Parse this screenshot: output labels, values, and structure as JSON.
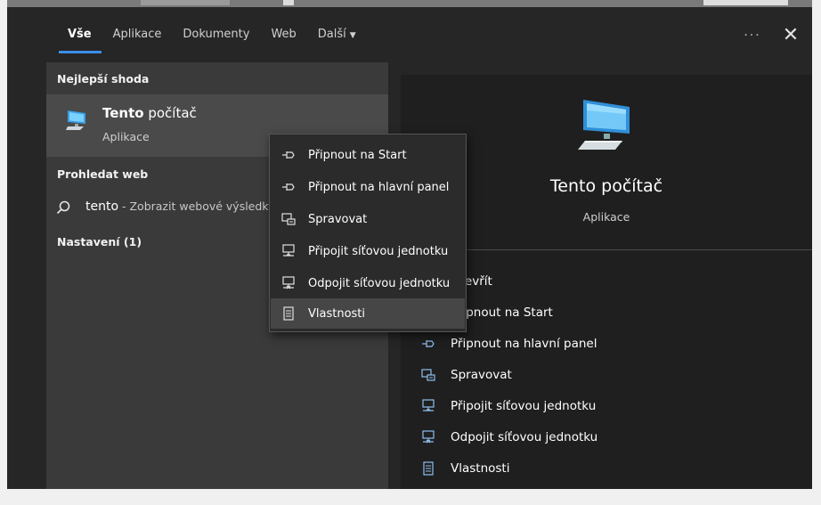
{
  "tabs": [
    {
      "label": "Vše",
      "active": true
    },
    {
      "label": "Aplikace",
      "active": false
    },
    {
      "label": "Dokumenty",
      "active": false
    },
    {
      "label": "Web",
      "active": false
    },
    {
      "label": "Další",
      "active": false,
      "dropdown": true
    }
  ],
  "header": {
    "more_icon": "ellipsis-icon",
    "more_label": "···",
    "close_icon": "close-icon",
    "close_label": "✕"
  },
  "best_match": {
    "section_title": "Nejlepší shoda",
    "title_bold": "Tento",
    "title_rest": " počítač",
    "subtitle": "Aplikace",
    "icon": "computer-icon"
  },
  "web_search": {
    "section_title": "Prohledat web",
    "query": "tento",
    "suffix": " - Zobrazit webové výsledky",
    "icon": "search-icon"
  },
  "settings": {
    "section_title": "Nastavení (1)"
  },
  "preview": {
    "title": "Tento počítač",
    "subtitle": "Aplikace",
    "icon": "computer-icon",
    "actions": [
      {
        "label": "Otevřít",
        "icon": "open-icon"
      },
      {
        "label": "Připnout na Start",
        "icon": "pin-icon"
      },
      {
        "label": "Připnout na hlavní panel",
        "icon": "pin-icon"
      },
      {
        "label": "Spravovat",
        "icon": "manage-icon"
      },
      {
        "label": "Připojit síťovou jednotku",
        "icon": "map-drive-icon"
      },
      {
        "label": "Odpojit síťovou jednotku",
        "icon": "disconnect-drive-icon"
      },
      {
        "label": "Vlastnosti",
        "icon": "properties-icon"
      }
    ]
  },
  "context_menu": {
    "items": [
      {
        "label": "Připnout na Start",
        "icon": "pin-icon"
      },
      {
        "label": "Připnout na hlavní panel",
        "icon": "pin-icon"
      },
      {
        "label": "Spravovat",
        "icon": "manage-icon"
      },
      {
        "label": "Připojit síťovou jednotku",
        "icon": "map-drive-icon"
      },
      {
        "label": "Odpojit síťovou jednotku",
        "icon": "disconnect-drive-icon"
      },
      {
        "label": "Vlastnosti",
        "icon": "properties-icon",
        "hovered": true
      }
    ]
  },
  "colors": {
    "accent": "#3b8ee6",
    "panel": "#262626",
    "list": "#3a3a3a",
    "selected": "#4a4a4a",
    "preview": "#1f1f1f",
    "menu": "#2b2b2b"
  }
}
